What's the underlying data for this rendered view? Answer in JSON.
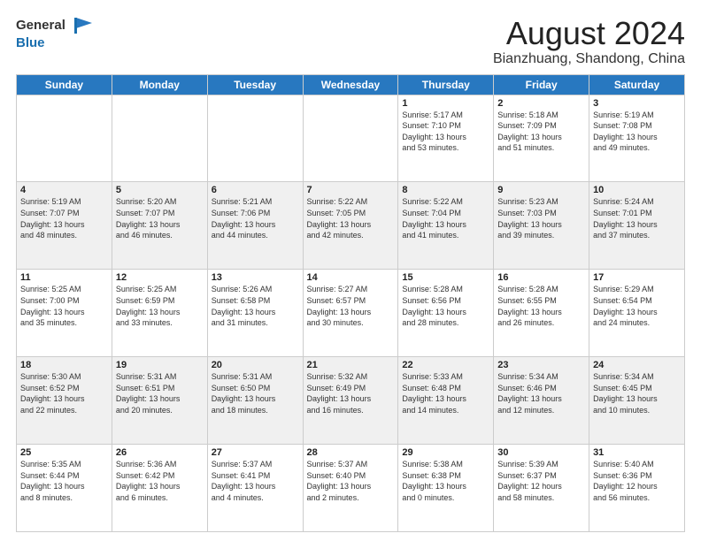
{
  "header": {
    "logo_general": "General",
    "logo_blue": "Blue",
    "month_year": "August 2024",
    "location": "Bianzhuang, Shandong, China"
  },
  "weekdays": [
    "Sunday",
    "Monday",
    "Tuesday",
    "Wednesday",
    "Thursday",
    "Friday",
    "Saturday"
  ],
  "weeks": [
    [
      {
        "day": "",
        "info": ""
      },
      {
        "day": "",
        "info": ""
      },
      {
        "day": "",
        "info": ""
      },
      {
        "day": "",
        "info": ""
      },
      {
        "day": "1",
        "info": "Sunrise: 5:17 AM\nSunset: 7:10 PM\nDaylight: 13 hours\nand 53 minutes."
      },
      {
        "day": "2",
        "info": "Sunrise: 5:18 AM\nSunset: 7:09 PM\nDaylight: 13 hours\nand 51 minutes."
      },
      {
        "day": "3",
        "info": "Sunrise: 5:19 AM\nSunset: 7:08 PM\nDaylight: 13 hours\nand 49 minutes."
      }
    ],
    [
      {
        "day": "4",
        "info": "Sunrise: 5:19 AM\nSunset: 7:07 PM\nDaylight: 13 hours\nand 48 minutes."
      },
      {
        "day": "5",
        "info": "Sunrise: 5:20 AM\nSunset: 7:07 PM\nDaylight: 13 hours\nand 46 minutes."
      },
      {
        "day": "6",
        "info": "Sunrise: 5:21 AM\nSunset: 7:06 PM\nDaylight: 13 hours\nand 44 minutes."
      },
      {
        "day": "7",
        "info": "Sunrise: 5:22 AM\nSunset: 7:05 PM\nDaylight: 13 hours\nand 42 minutes."
      },
      {
        "day": "8",
        "info": "Sunrise: 5:22 AM\nSunset: 7:04 PM\nDaylight: 13 hours\nand 41 minutes."
      },
      {
        "day": "9",
        "info": "Sunrise: 5:23 AM\nSunset: 7:03 PM\nDaylight: 13 hours\nand 39 minutes."
      },
      {
        "day": "10",
        "info": "Sunrise: 5:24 AM\nSunset: 7:01 PM\nDaylight: 13 hours\nand 37 minutes."
      }
    ],
    [
      {
        "day": "11",
        "info": "Sunrise: 5:25 AM\nSunset: 7:00 PM\nDaylight: 13 hours\nand 35 minutes."
      },
      {
        "day": "12",
        "info": "Sunrise: 5:25 AM\nSunset: 6:59 PM\nDaylight: 13 hours\nand 33 minutes."
      },
      {
        "day": "13",
        "info": "Sunrise: 5:26 AM\nSunset: 6:58 PM\nDaylight: 13 hours\nand 31 minutes."
      },
      {
        "day": "14",
        "info": "Sunrise: 5:27 AM\nSunset: 6:57 PM\nDaylight: 13 hours\nand 30 minutes."
      },
      {
        "day": "15",
        "info": "Sunrise: 5:28 AM\nSunset: 6:56 PM\nDaylight: 13 hours\nand 28 minutes."
      },
      {
        "day": "16",
        "info": "Sunrise: 5:28 AM\nSunset: 6:55 PM\nDaylight: 13 hours\nand 26 minutes."
      },
      {
        "day": "17",
        "info": "Sunrise: 5:29 AM\nSunset: 6:54 PM\nDaylight: 13 hours\nand 24 minutes."
      }
    ],
    [
      {
        "day": "18",
        "info": "Sunrise: 5:30 AM\nSunset: 6:52 PM\nDaylight: 13 hours\nand 22 minutes."
      },
      {
        "day": "19",
        "info": "Sunrise: 5:31 AM\nSunset: 6:51 PM\nDaylight: 13 hours\nand 20 minutes."
      },
      {
        "day": "20",
        "info": "Sunrise: 5:31 AM\nSunset: 6:50 PM\nDaylight: 13 hours\nand 18 minutes."
      },
      {
        "day": "21",
        "info": "Sunrise: 5:32 AM\nSunset: 6:49 PM\nDaylight: 13 hours\nand 16 minutes."
      },
      {
        "day": "22",
        "info": "Sunrise: 5:33 AM\nSunset: 6:48 PM\nDaylight: 13 hours\nand 14 minutes."
      },
      {
        "day": "23",
        "info": "Sunrise: 5:34 AM\nSunset: 6:46 PM\nDaylight: 13 hours\nand 12 minutes."
      },
      {
        "day": "24",
        "info": "Sunrise: 5:34 AM\nSunset: 6:45 PM\nDaylight: 13 hours\nand 10 minutes."
      }
    ],
    [
      {
        "day": "25",
        "info": "Sunrise: 5:35 AM\nSunset: 6:44 PM\nDaylight: 13 hours\nand 8 minutes."
      },
      {
        "day": "26",
        "info": "Sunrise: 5:36 AM\nSunset: 6:42 PM\nDaylight: 13 hours\nand 6 minutes."
      },
      {
        "day": "27",
        "info": "Sunrise: 5:37 AM\nSunset: 6:41 PM\nDaylight: 13 hours\nand 4 minutes."
      },
      {
        "day": "28",
        "info": "Sunrise: 5:37 AM\nSunset: 6:40 PM\nDaylight: 13 hours\nand 2 minutes."
      },
      {
        "day": "29",
        "info": "Sunrise: 5:38 AM\nSunset: 6:38 PM\nDaylight: 13 hours\nand 0 minutes."
      },
      {
        "day": "30",
        "info": "Sunrise: 5:39 AM\nSunset: 6:37 PM\nDaylight: 12 hours\nand 58 minutes."
      },
      {
        "day": "31",
        "info": "Sunrise: 5:40 AM\nSunset: 6:36 PM\nDaylight: 12 hours\nand 56 minutes."
      }
    ]
  ]
}
